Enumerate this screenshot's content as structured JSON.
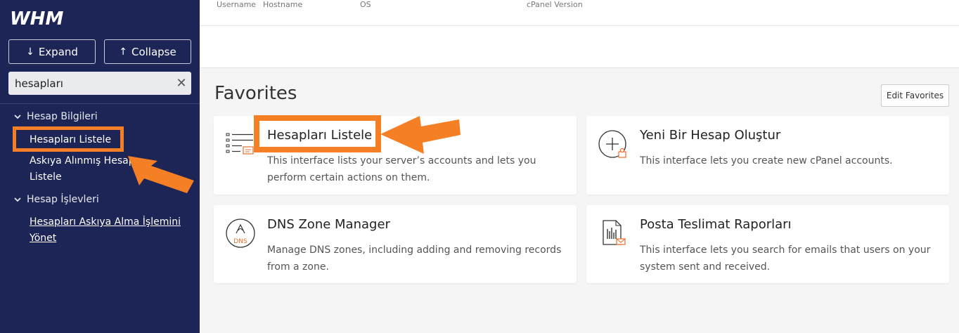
{
  "brand": {
    "logo_text": "WHM"
  },
  "sidebar": {
    "expand_label": "Expand",
    "collapse_label": "Collapse",
    "search": {
      "value": "hesapları",
      "placeholder": ""
    },
    "groups": [
      {
        "label": "Hesap Bilgileri",
        "items": [
          {
            "label": "Hesapları Listele"
          },
          {
            "label": "Askıya Alınmış Hesap",
            "label2": "Listele"
          }
        ]
      },
      {
        "label": "Hesap İşlevleri",
        "items": [
          {
            "label": "Hesapları Askıya Alma İşlemini",
            "label2": "Yönet"
          }
        ]
      }
    ]
  },
  "header_columns": [
    "Username",
    "Hostname",
    "OS",
    "cPanel Version"
  ],
  "favorites": {
    "title": "Favorites",
    "edit_label": "Edit Favorites",
    "cards": [
      {
        "title": "Hesapları Listele",
        "desc": "This interface lists your server’s accounts and lets you perform certain actions on them.",
        "icon": "list-icon"
      },
      {
        "title": "Yeni Bir Hesap Oluştur",
        "desc": "This interface lets you create new cPanel accounts.",
        "icon": "add-account-icon"
      },
      {
        "title": "DNS Zone Manager",
        "desc": "Manage DNS zones, including adding and removing records from a zone.",
        "icon": "dns-icon",
        "icon_text": "DNS"
      },
      {
        "title": "Posta Teslimat Raporları",
        "desc": "This interface lets you search for emails that users on your system sent and received.",
        "icon": "mail-report-icon"
      }
    ]
  },
  "colors": {
    "sidebar_bg": "#1c2555",
    "highlight": "#f47f24",
    "icon_accent": "#e8702a"
  }
}
